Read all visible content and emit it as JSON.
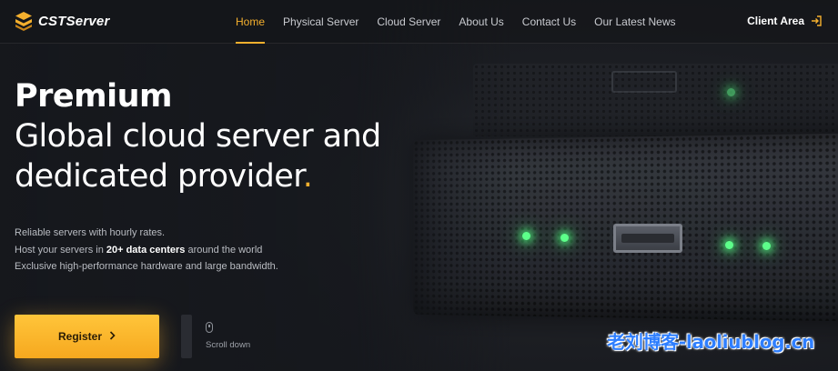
{
  "nav": {
    "logo_text": "CSTServer",
    "items": [
      {
        "label": "Home",
        "active": true
      },
      {
        "label": "Physical Server",
        "active": false
      },
      {
        "label": "Cloud Server",
        "active": false
      },
      {
        "label": "About Us",
        "active": false
      },
      {
        "label": "Contact Us",
        "active": false
      },
      {
        "label": "Our Latest News",
        "active": false
      }
    ],
    "client_area": "Client Area"
  },
  "hero": {
    "premium": "Premium",
    "line1": "Global cloud server and",
    "line2": "dedicated provider",
    "line2_dot": ".",
    "desc1": "Reliable servers with hourly rates.",
    "desc2_pre": "Host your servers in ",
    "desc2_bold": "20+ data centers",
    "desc2_post": " around the world",
    "desc3": "Exclusive high-performance hardware and large bandwidth."
  },
  "cta": {
    "register": "Register",
    "scroll_down": "Scroll down"
  },
  "watermark": "老刘博客-laoliublog.cn",
  "colors": {
    "accent": "#f5b02e",
    "background": "#16181d",
    "led": "#5dff8a"
  }
}
